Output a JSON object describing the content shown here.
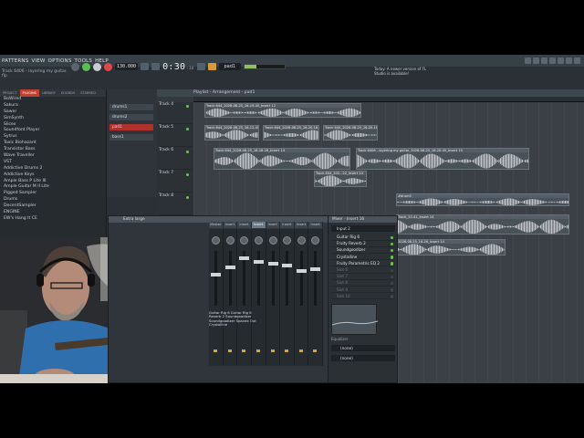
{
  "menu": [
    "PATTERNS",
    "VIEW",
    "OPTIONS",
    "TOOLS",
    "HELP"
  ],
  "hint_bar": "Track 6406 - layering my guitar. flp",
  "transport": {
    "tempo": "130.000",
    "time": "0:30",
    "time_sub": ":34",
    "pattern": "pad1"
  },
  "news": "Today: A newer version of FL Studio is available!",
  "browser": {
    "tabs": [
      "PROJECT",
      "PLUGINS",
      "LIBRARY",
      "SOUNDS",
      "STARRED"
    ],
    "active_tab": 1,
    "items": [
      "BoWired",
      "Sakura",
      "Sawer",
      "SimSynth",
      "Slicex",
      "Soundfont Player",
      "Sytrus",
      "Toxic Biohazard",
      "Transistor Bass",
      "Wave Traveller",
      "VST",
      "Addictive Drums 2",
      "Addictive Keys",
      "Ample Bass P Lite III",
      "Ample Guitar M II Lite",
      "Pigged Sampler",
      "Drums",
      "DecentSampler",
      "ENGINE",
      "EW's Hang It CE"
    ]
  },
  "channel_rack": {
    "channels": [
      {
        "name": "drums1",
        "selected": false
      },
      {
        "name": "drums2",
        "selected": false
      },
      {
        "name": "pad1",
        "selected": true
      },
      {
        "name": "bass1",
        "selected": false
      }
    ]
  },
  "playlist": {
    "title": "Playlist - Arrangement - pad1",
    "tracks": [
      "Track 4",
      "Track 5",
      "Track 6",
      "Track 7",
      "Track 8"
    ],
    "clips": [
      {
        "name": "Track 644_2026-08-25_16-19-45_Insert 12",
        "track": 0
      },
      {
        "name": "Track 644_2026-08-25_16-12-45_Insert 11",
        "track": 1
      },
      {
        "name": "Track 644_2026-08-25_16-20-16_Insert 16",
        "track": 1
      },
      {
        "name": "Track 644_2026-08-25_16-20-16_Insert 18",
        "track": 1
      },
      {
        "name": "Track 644_2026-08-25_16-18-26_Insert 14",
        "track": 2
      },
      {
        "name": "Track 6406 - layering my guitar_2026-08-25_16-20-45_Insert 15",
        "track": 2
      },
      {
        "name": "Track 644_202...22_Insert 14",
        "track": 3
      },
      {
        "name": "#drum5",
        "track": 4
      },
      {
        "name": "Track_22-41_Insert 14",
        "track": 5
      },
      {
        "name": "2026-08-25_16-26_Insert 14",
        "track": 6
      }
    ]
  },
  "mixer": {
    "title": "Extra large",
    "inserts": [
      "Master",
      "Insert 14",
      "Insert 15",
      "Insert 16",
      "Insert 17",
      "Insert 18",
      "Insert 19",
      "Insert 20"
    ],
    "active_insert": 3,
    "strip_labels": "Guitar Rig 6  Guitar Rig 6\nReverb 2  Soundgoodizer\nSoundgoodizer  Spaced Out\nCrystalline",
    "fx_title": "Mixer - Insert 16",
    "input": "Input 2",
    "slots": [
      "Guitar Rig 6",
      "Fruity Reverb 2",
      "Soundgoodizer",
      "Crystalline",
      "Fruity Parametric EQ 2",
      "Slot 6",
      "Slot 7",
      "Slot 8",
      "Slot 9",
      "Slot 10"
    ],
    "equalizer": "Equalizer",
    "outputs": [
      "(none)",
      "(none)"
    ]
  }
}
